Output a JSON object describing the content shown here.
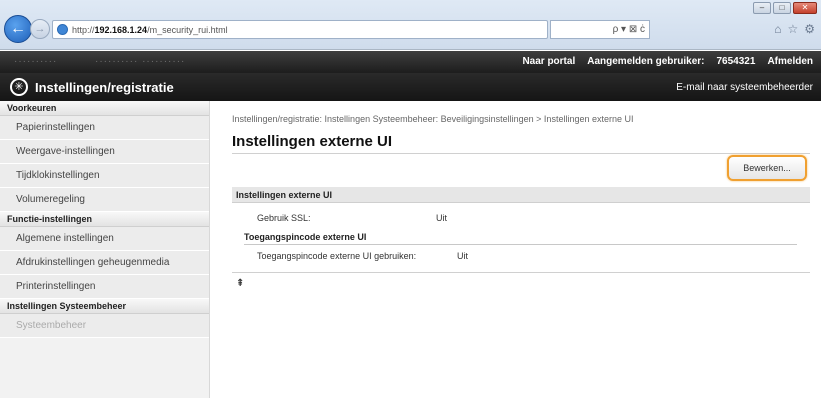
{
  "browser": {
    "url_prefix": "http://",
    "url_host": "192.168.1.24",
    "url_path": "/m_security_rui.html",
    "search_controls": "ρ ▾ ⊠ ċ",
    "win_minimize": "–",
    "win_maximize": "□",
    "win_close": "✕",
    "nav_back": "←",
    "nav_forward": "→",
    "home_icon": "⌂",
    "favorites_icon": "☆",
    "tools_icon": "⚙"
  },
  "header": {
    "brand_blurred_1": "··········",
    "brand_blurred_2": "··········  ··········",
    "portal_link": "Naar portal",
    "logged_in_label": "Aangemelden gebruiker:",
    "logged_in_user": "7654321",
    "logout_link": "Afmelden",
    "app_title": "Instellingen/registratie",
    "admin_mail_link": "E-mail naar systeembeheerder"
  },
  "sidebar": {
    "groups": [
      {
        "heading": "Voorkeuren",
        "items": [
          "Papierinstellingen",
          "Weergave-instellingen",
          "Tijdklokinstellingen",
          "Volumeregeling"
        ]
      },
      {
        "heading": "Functie-instellingen",
        "items": [
          "Algemene instellingen",
          "Afdrukinstellingen geheugenmedia",
          "Printerinstellingen"
        ]
      },
      {
        "heading": "Instellingen Systeembeheer",
        "items": [
          "Systeembeheer"
        ]
      }
    ]
  },
  "main": {
    "breadcrumb": "Instellingen/registratie: Instellingen Systeembeheer: Beveiligingsinstellingen > Instellingen externe UI",
    "title": "Instellingen externe UI",
    "edit_button": "Bewerken...",
    "section_title": "Instellingen externe UI",
    "ssl_label": "Gebruik SSL:",
    "ssl_value": "Uit",
    "pin_subheading": "Toegangspincode externe UI",
    "pin_label": "Toegangspincode externe UI gebruiken:",
    "pin_value": "Uit",
    "to_top_icon": "⇞"
  }
}
